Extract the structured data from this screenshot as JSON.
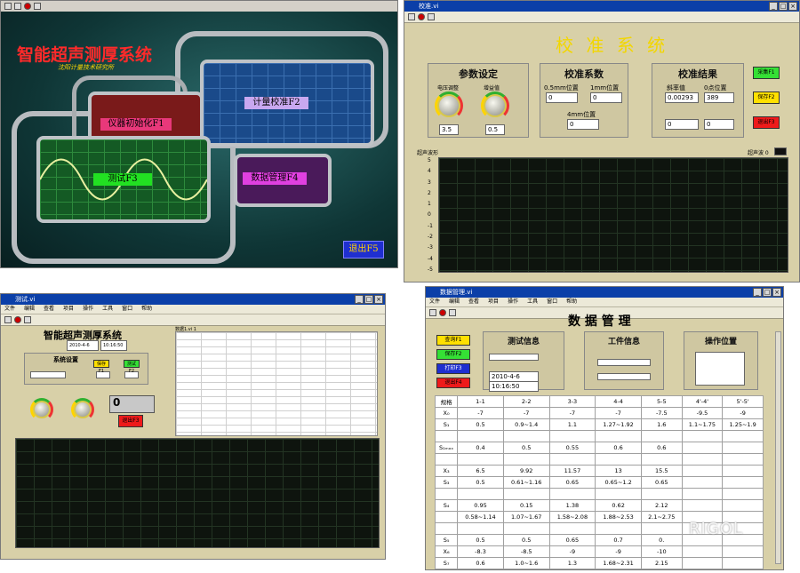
{
  "win1": {
    "title": "智能超声测厚系统",
    "subtitle": "沈阳计量技术研究所",
    "buttons": [
      "仪器初始化F1",
      "计量校准F2",
      "测试F3",
      "数据管理F4",
      "退出F5"
    ]
  },
  "win2": {
    "title": "校准.vi",
    "heading": "校 准 系 统",
    "params_title": "参数设定",
    "knob1_label": "电压调整",
    "knob1_value": "3.5",
    "knob2_label": "增益值",
    "knob2_value": "0.5",
    "coef_title": "校准系数",
    "coef_l1": "0.5mm位置",
    "coef_l2": "1mm位置",
    "coef_l3": "4mm位置",
    "coef_v1": "0",
    "coef_v2": "0",
    "coef_v3": "0",
    "result_title": "校准结果",
    "res_h1": "斜率值",
    "res_h2": "0点位置",
    "res_v1": "0.00293",
    "res_v2": "389",
    "res_v3": "0",
    "res_v4": "0",
    "btn1": "采集F1",
    "btn2": "保存F2",
    "btn3": "退出F3",
    "scope_label": "超声波 0",
    "graph_label": "超声波形",
    "y_ticks": [
      "5",
      "4",
      "3",
      "2",
      "1",
      "0",
      "-1",
      "-2",
      "-3",
      "-4",
      "-5"
    ]
  },
  "win3": {
    "title": "测试.vi",
    "heading": "智能超声测厚系统",
    "date": "2010-4-6",
    "time": "10:16:50",
    "settings_title": "系统设置",
    "btn_save": "保存F1",
    "btn_run": "测试F2",
    "thickness": "0",
    "btn_exit": "退出F3",
    "table_title": "数据1.vi 1"
  },
  "win4": {
    "title": "数据管理.vi",
    "heading": "数 据 管 理",
    "test_info": "测试信息",
    "work_info": "工件信息",
    "op_pos": "操作位置",
    "date_val": "2010-4-6",
    "time_val": "10:16:50",
    "btns": [
      "查询F1",
      "保存F2",
      "打印F3",
      "退出F4"
    ],
    "table": {
      "headers": [
        "规格",
        "1-1",
        "2-2",
        "3-3",
        "4-4",
        "5-5",
        "4'-4'",
        "5'-5'"
      ],
      "rows": [
        [
          "X₀",
          "-7",
          "-7",
          "-7",
          "-7",
          "-7.5",
          "-9.5",
          "-9"
        ],
        [
          "S₁",
          "0.5",
          "0.9~1.4",
          "1.1",
          "1.27~1.92",
          "1.6",
          "1.1~1.75",
          "1.25~1.9"
        ],
        [
          "",
          "",
          "",
          "",
          "",
          "",
          "",
          ""
        ],
        [
          "S₁ₘₐₓ",
          "0.4",
          "0.5",
          "0.55",
          "0.6",
          "0.6",
          "",
          ""
        ],
        [
          "",
          "",
          "",
          "",
          "",
          "",
          "",
          ""
        ],
        [
          "X₃",
          "6.5",
          "9.92",
          "11.57",
          "13",
          "15.5",
          "",
          ""
        ],
        [
          "S₃",
          "0.5",
          "0.61~1.16",
          "0.65",
          "0.65~1.2",
          "0.65",
          "",
          ""
        ],
        [
          "",
          "",
          "",
          "",
          "",
          "",
          "",
          ""
        ],
        [
          "S₄",
          "0.95",
          "0.15",
          "1.38",
          "0.62",
          "2.12",
          "",
          ""
        ],
        [
          "",
          "0.58~1.14",
          "1.07~1.67",
          "1.58~2.08",
          "1.88~2.53",
          "2.1~2.75",
          "",
          ""
        ],
        [
          "",
          "",
          "",
          "",
          "",
          "",
          "",
          ""
        ],
        [
          "S₅",
          "0.5",
          "0.5",
          "0.65",
          "0.7",
          "0.",
          "",
          ""
        ],
        [
          "X₆",
          "-8.3",
          "-8.5",
          "-9",
          "-9",
          "-10",
          "",
          ""
        ],
        [
          "S₇",
          "0.6",
          "1.0~1.6",
          "1.3",
          "1.68~2.31",
          "2.15",
          "",
          ""
        ]
      ]
    },
    "watermark": "RIGOL"
  }
}
